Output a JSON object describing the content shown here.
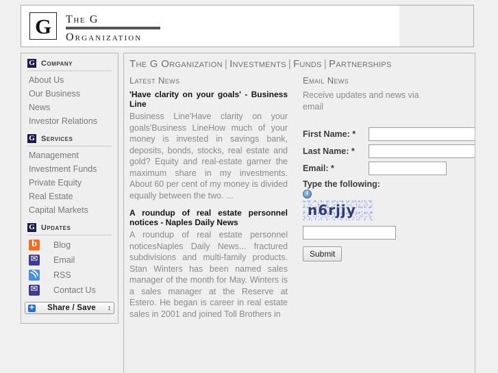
{
  "brand": {
    "mark": "G",
    "line1": "The G",
    "line2": "Organization"
  },
  "sidebar": {
    "groups": [
      {
        "badge": "G",
        "heading": "Company",
        "links": [
          {
            "label": "About Us"
          },
          {
            "label": "Our Business"
          },
          {
            "label": "News"
          },
          {
            "label": "Investor Relations"
          }
        ]
      },
      {
        "badge": "G",
        "heading": "Services",
        "links": [
          {
            "label": "Management"
          },
          {
            "label": "Investment Funds"
          },
          {
            "label": "Private Equity"
          },
          {
            "label": "Real Estate"
          },
          {
            "label": "Capital Markets"
          }
        ]
      },
      {
        "badge": "G",
        "heading": "Updates",
        "icon_links": [
          {
            "icon": "blogger-icon",
            "label": "Blog"
          },
          {
            "icon": "envelope-icon",
            "label": "Email"
          },
          {
            "icon": "rss-icon",
            "label": "RSS"
          },
          {
            "icon": "envelope-icon",
            "label": "Contact Us"
          }
        ]
      }
    ],
    "share": {
      "label": "Share / Save",
      "caret": "↕"
    }
  },
  "topnav": {
    "items": [
      "The G Organization",
      "Investments",
      "Funds",
      "Partnerships"
    ],
    "separator": "|"
  },
  "latest_news": {
    "heading": "Latest News",
    "articles": [
      {
        "title": "'Have clarity on your goals' - Business Line",
        "body": "Business Line'Have clarity on your goals'Business LineHow much of your money is invested in savings bank, deposits, bonds, stocks, real estate and gold? Equity and real-estate garner the maximum share in my investments. About 60 per cent of my money is divided equally between the two. ..."
      },
      {
        "title": "A roundup of real estate personnel notices - Naples Daily News",
        "body": "A roundup of real estate personnel noticesNaples Daily News... fractured subdivisions and multi-family products. Stan Winters has been named sales manager of the month for May. Winters is a sales manager at the Reserve at Estero. He began is career in real estate sales in 2001 and joined Toll Brothers in"
      }
    ]
  },
  "email_news": {
    "heading": "Email News",
    "subtitle": "Receive updates and news via email",
    "fields": [
      {
        "label": "First Name: *",
        "value": "",
        "placeholder": ""
      },
      {
        "label": "Last Name: *",
        "value": "",
        "placeholder": ""
      },
      {
        "label": "Email: *",
        "value": "",
        "placeholder": ""
      }
    ],
    "captcha": {
      "label": "Type the following:",
      "text": "n6rjjy",
      "input_value": "",
      "input_placeholder": ""
    },
    "submit_label": "Submit"
  },
  "colors": {
    "page_bg": "#f0f0f0",
    "panel_bg": "#efefef",
    "badge_navy": "#1b1b4b",
    "body_text": "#8a8a8a",
    "heading_text": "#6e6e6e",
    "captcha_ink": "#2d3c7a",
    "blogger_orange": "#f26c22",
    "rss_blue": "#4a90d9"
  }
}
